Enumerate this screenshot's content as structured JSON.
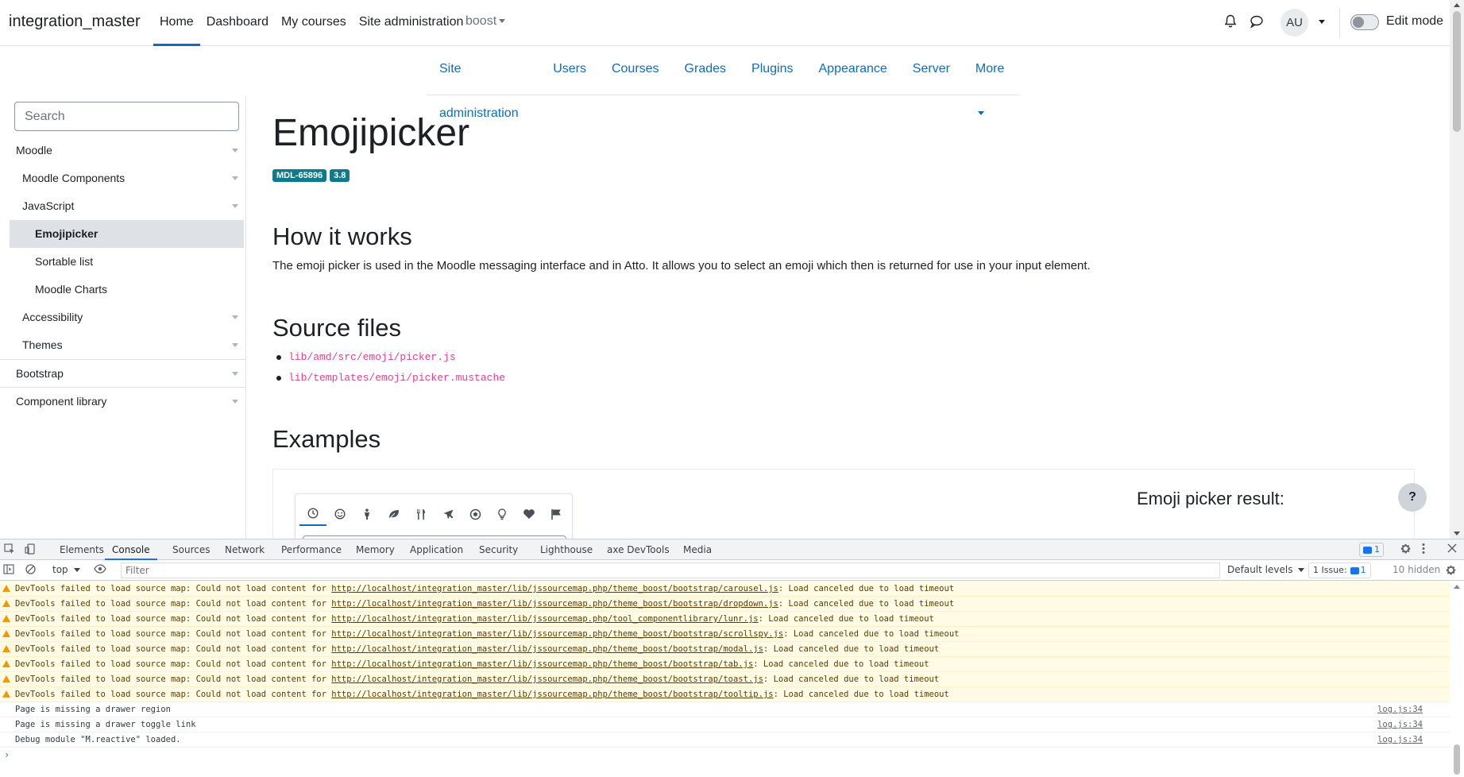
{
  "navbar": {
    "brand": "integration_master",
    "items": [
      "Home",
      "Dashboard",
      "My courses",
      "Site administration"
    ],
    "theme_dropdown": "boost",
    "avatar_initials": "AU",
    "edit_mode_label": "Edit mode"
  },
  "secondary_nav": {
    "items": [
      "Site administration",
      "Users",
      "Courses",
      "Grades",
      "Plugins",
      "Appearance",
      "Server"
    ],
    "more": "More"
  },
  "sidebar": {
    "search_placeholder": "Search",
    "tree": [
      {
        "label": "Moodle",
        "level": 0
      },
      {
        "label": "Moodle Components",
        "level": 1
      },
      {
        "label": "JavaScript",
        "level": 1
      },
      {
        "label": "Emojipicker",
        "level": 2
      },
      {
        "label": "Sortable list",
        "level": 2
      },
      {
        "label": "Moodle Charts",
        "level": 2
      },
      {
        "label": "Accessibility",
        "level": 1
      },
      {
        "label": "Themes",
        "level": 1
      },
      {
        "label": "Bootstrap",
        "level": 0
      },
      {
        "label": "Component library",
        "level": 0
      }
    ]
  },
  "main": {
    "title": "Emojipicker",
    "badges": [
      "MDL-65896",
      "3.8"
    ],
    "how_heading": "How it works",
    "how_text": "The emoji picker is used in the Moodle messaging interface and in Atto. It allows you to select an emoji which then is returned for use in your input element.",
    "source_heading": "Source files",
    "source_files": [
      "lib/amd/src/emoji/picker.js",
      "lib/templates/emoji/picker.mustache"
    ],
    "examples_heading": "Examples",
    "picker_tabs": [
      "clock-icon",
      "smiley-icon",
      "person-icon",
      "leaf-icon",
      "utensils-icon",
      "plane-icon",
      "ball-icon",
      "lightbulb-icon",
      "heart-icon",
      "flag-icon"
    ],
    "result_title": "Emoji picker result:",
    "help_button": "?"
  },
  "devtools": {
    "tabs": [
      "Elements",
      "Console",
      "Sources",
      "Network",
      "Performance",
      "Memory",
      "Application",
      "Security",
      "Lighthouse",
      "axe DevTools",
      "Media"
    ],
    "issue_chip_count": "1",
    "context": "top",
    "filter_placeholder": "Filter",
    "levels": "Default levels",
    "issues_label": "1 Issue:",
    "issues_count": "1",
    "hidden_label": "10 hidden",
    "warnings": [
      {
        "prefix": "DevTools failed to load source map: Could not load content for ",
        "url": "http://localhost/integration_master/lib/jssourcemap.php/theme_boost/bootstrap/carousel.js",
        "suffix": ": Load canceled due to load timeout"
      },
      {
        "prefix": "DevTools failed to load source map: Could not load content for ",
        "url": "http://localhost/integration_master/lib/jssourcemap.php/theme_boost/bootstrap/dropdown.js",
        "suffix": ": Load canceled due to load timeout"
      },
      {
        "prefix": "DevTools failed to load source map: Could not load content for ",
        "url": "http://localhost/integration_master/lib/jssourcemap.php/tool_componentlibrary/lunr.js",
        "suffix": ": Load canceled due to load timeout"
      },
      {
        "prefix": "DevTools failed to load source map: Could not load content for ",
        "url": "http://localhost/integration_master/lib/jssourcemap.php/theme_boost/bootstrap/scrollspy.js",
        "suffix": ": Load canceled due to load timeout"
      },
      {
        "prefix": "DevTools failed to load source map: Could not load content for ",
        "url": "http://localhost/integration_master/lib/jssourcemap.php/theme_boost/bootstrap/modal.js",
        "suffix": ": Load canceled due to load timeout"
      },
      {
        "prefix": "DevTools failed to load source map: Could not load content for ",
        "url": "http://localhost/integration_master/lib/jssourcemap.php/theme_boost/bootstrap/tab.js",
        "suffix": ": Load canceled due to load timeout"
      },
      {
        "prefix": "DevTools failed to load source map: Could not load content for ",
        "url": "http://localhost/integration_master/lib/jssourcemap.php/theme_boost/bootstrap/toast.js",
        "suffix": ": Load canceled due to load timeout"
      },
      {
        "prefix": "DevTools failed to load source map: Could not load content for ",
        "url": "http://localhost/integration_master/lib/jssourcemap.php/theme_boost/bootstrap/tooltip.js",
        "suffix": ": Load canceled due to load timeout"
      }
    ],
    "logs": [
      {
        "text": "Page is missing a drawer region",
        "source": "log.js:34"
      },
      {
        "text": "Page is missing a drawer toggle link",
        "source": "log.js:34"
      },
      {
        "text": "Debug module \"M.reactive\" loaded.",
        "source": "log.js:34"
      }
    ],
    "prompt": "›"
  }
}
